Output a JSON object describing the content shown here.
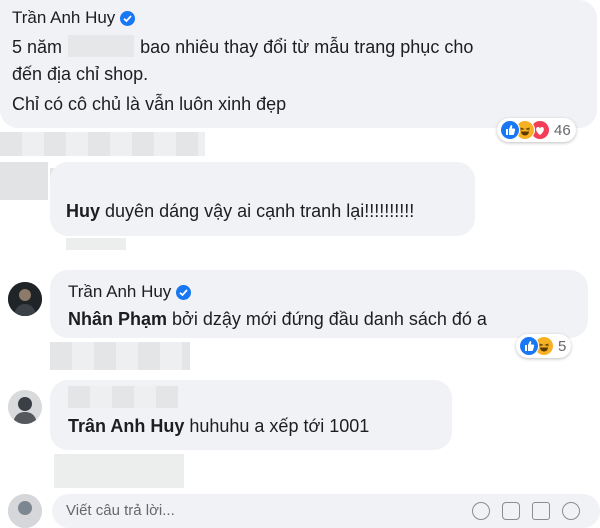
{
  "comments": [
    {
      "author": "Trần Anh Huy",
      "verified": true,
      "line1_start": "5 năm",
      "line1_end": "bao nhiêu thay đổi từ mẫu trang phục cho",
      "line2": "đến địa chỉ shop.",
      "line3": "Chỉ có cô chủ là vẫn luôn xinh đẹp",
      "reaction_count": "46",
      "reactions": [
        "like-icon",
        "haha-icon",
        "love-icon"
      ]
    },
    {
      "mention": "Huy",
      "text": "duyên dáng vậy ai cạnh tranh lại!!!!!!!!!!"
    },
    {
      "author": "Trần Anh Huy",
      "verified": true,
      "mention": "Nhân Phạm",
      "text": "bởi dzậy mới đứng đầu danh sách đó a",
      "reaction_count": "5",
      "reactions": [
        "like-icon",
        "haha-icon"
      ]
    },
    {
      "mention": "Trân Anh Huy",
      "text": "huhuhu a xếp tới 1001"
    }
  ],
  "reply": {
    "placeholder": "Viết câu trả lời..."
  },
  "colors": {
    "bubble": "#f0f2f5",
    "like": "#1877f2",
    "haha": "#f7b125",
    "love": "#f33e58",
    "meta": "#65676b"
  }
}
